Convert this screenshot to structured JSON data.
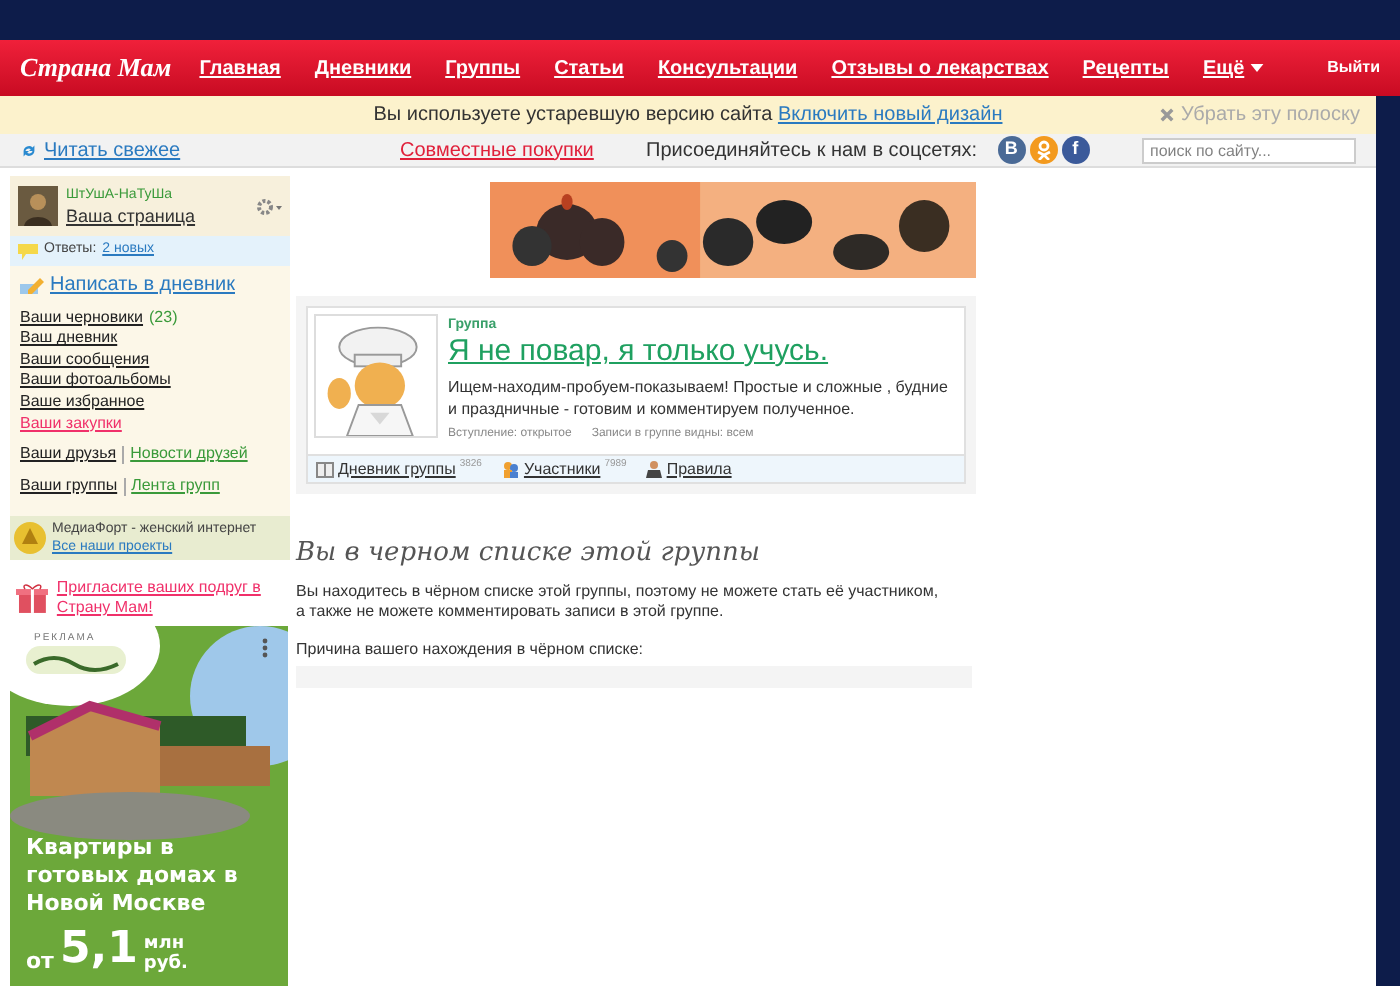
{
  "header": {
    "logo": "Страна Мам",
    "nav": [
      {
        "label": "Главная",
        "dropdown": false
      },
      {
        "label": "Дневники",
        "dropdown": false
      },
      {
        "label": "Группы",
        "dropdown": false
      },
      {
        "label": "Статьи",
        "dropdown": false
      },
      {
        "label": "Консультации",
        "dropdown": false
      },
      {
        "label": "Отзывы о лекарствах",
        "dropdown": false
      },
      {
        "label": "Рецепты",
        "dropdown": false
      },
      {
        "label": "Ещё",
        "dropdown": true
      }
    ],
    "logout": "Выйти"
  },
  "notice": {
    "text": "Вы используете устаревшую версию сайта",
    "link": "Включить новый дизайн",
    "dismiss": "Убрать эту полоску"
  },
  "toolbar": {
    "read_fresh": "Читать свежее",
    "joint_purchases": "Совместные покупки",
    "social_label": "Присоединяйтесь к нам в соцсетях:",
    "social": [
      {
        "kind": "letter",
        "text": "В",
        "color": "#4a6a96"
      },
      {
        "kind": "ok",
        "color": "#f39a1e"
      },
      {
        "kind": "letter",
        "text": "f",
        "color": "#3b5a9a"
      }
    ],
    "search": {
      "placeholder": "поиск по сайту..."
    }
  },
  "sidebar": {
    "user_name": "ШтУшА-НаТуШа",
    "my_page": "Ваша страница",
    "replies_label": "Ответы:",
    "replies_link": "2 новых",
    "write": "Написать в дневник",
    "links": [
      {
        "text": "Ваши черновики",
        "count": "(23)",
        "kind": "normal"
      },
      {
        "text": "Ваш дневник",
        "kind": "normal"
      },
      {
        "text": "Ваши сообщения",
        "kind": "normal"
      },
      {
        "text": "Ваши фотоальбомы",
        "kind": "normal"
      },
      {
        "text": "Ваше избранное",
        "kind": "normal"
      },
      {
        "text": "Ваши закупки",
        "kind": "highlight"
      }
    ],
    "pairs": [
      {
        "main": "Ваши друзья",
        "extra": "Новости друзей"
      },
      {
        "main": "Ваши группы",
        "extra": "Лента групп"
      }
    ],
    "network": {
      "title": "МедиаФорт - женский интернет",
      "link": "Все наши проекты"
    },
    "invite": "Пригласите ваших подруг в Страну Мам!",
    "ad": {
      "label": "РЕКЛАМА",
      "headline": "Квартиры в готовых домах в Новой Москве",
      "from": "от",
      "price": "5,1",
      "unit_1": "млн",
      "unit_2": "руб."
    }
  },
  "group": {
    "type_label": "Группа",
    "title": "Я не повар, я только учусь.",
    "description": "Ищем-находим-пробуем-показываем! Простые и сложные , будние и праздничные - готовим и комментируем полученное.",
    "meta": [
      {
        "label": "Вступление:",
        "value": "открытое"
      },
      {
        "label": "Записи в группе видны:",
        "value": "всем"
      }
    ],
    "tabs": [
      {
        "kind": "diary",
        "label": "Дневник группы",
        "count": "3826"
      },
      {
        "kind": "members",
        "label": "Участники",
        "count": "7989"
      },
      {
        "kind": "rules",
        "label": "Правила"
      }
    ]
  },
  "blacklist": {
    "heading": "Вы в черном списке этой группы",
    "text": "Вы находитесь в чёрном списке этой группы, поэтому не можете стать её участником,",
    "text_2": "а также не можете комментировать записи в этой группе.",
    "reason_label": "Причина вашего нахождения в чёрном списке:"
  }
}
